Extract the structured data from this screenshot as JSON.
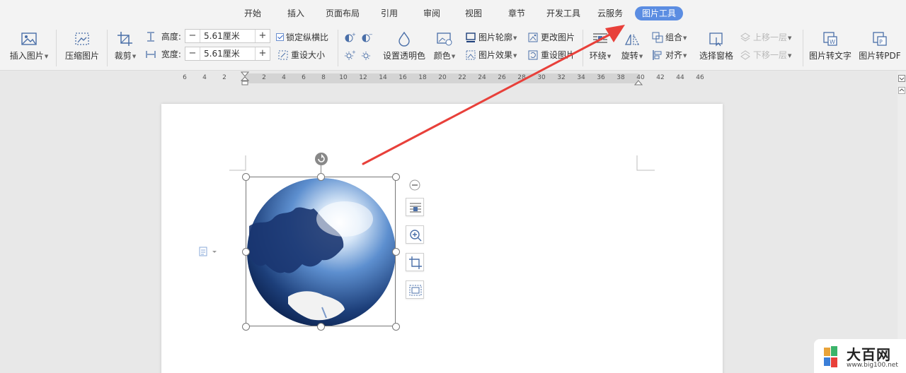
{
  "tabs": [
    "开始",
    "插入",
    "页面布局",
    "引用",
    "审阅",
    "视图",
    "章节",
    "开发工具",
    "云服务",
    "图片工具"
  ],
  "active_tab": "图片工具",
  "ribbon": {
    "insert_picture": "插入图片",
    "compress_picture": "压缩图片",
    "crop": "裁剪",
    "height_label": "高度:",
    "height_value": "5.61厘米",
    "width_label": "宽度:",
    "width_value": "5.61厘米",
    "minus": "−",
    "plus": "+",
    "lock_ratio": "锁定纵横比",
    "reset_size": "重设大小",
    "set_transparent": "设置透明色",
    "color": "颜色",
    "outline": "图片轮廓",
    "effects": "图片效果",
    "change_picture": "更改图片",
    "reset_picture": "重设图片",
    "wrap": "环绕",
    "rotate": "旋转",
    "group": "组合",
    "align": "对齐",
    "selection_pane": "选择窗格",
    "bring_forward": "上移一层",
    "send_backward": "下移一层",
    "to_text": "图片转文字",
    "to_pdf": "图片转PDF"
  },
  "ruler": [
    "6",
    "4",
    "2",
    "2",
    "4",
    "6",
    "8",
    "10",
    "12",
    "14",
    "16",
    "18",
    "20",
    "22",
    "24",
    "26",
    "28",
    "30",
    "32",
    "34",
    "36",
    "38",
    "40",
    "42",
    "44",
    "46"
  ],
  "logo": {
    "title": "大百网",
    "url": "www.big100.net"
  },
  "colors": {
    "accent": "#5b8de2",
    "arrow": "#e8403a",
    "globe_dark": "#1d3f7a",
    "globe_light": "#7fb0e8"
  }
}
